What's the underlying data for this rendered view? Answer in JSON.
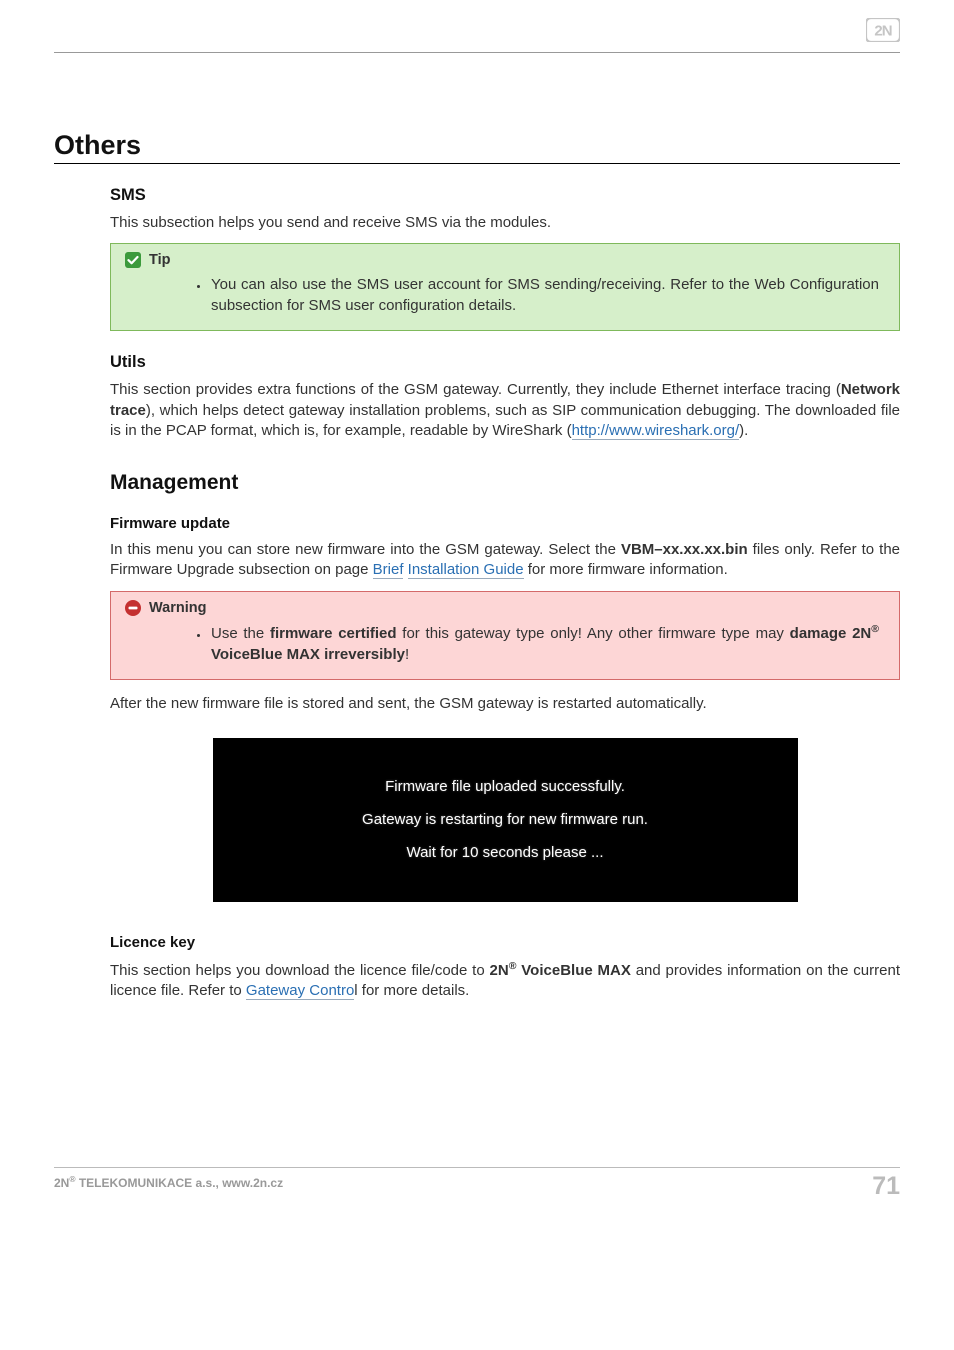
{
  "brand": "2N",
  "section_title": "Others",
  "sms": {
    "heading": "SMS",
    "intro": "This subsection helps you send and receive SMS via the modules.",
    "tip_label": "Tip",
    "tip_text": "You can also use the SMS user account for SMS sending/receiving. Refer to the Web Configuration subsection for SMS user configuration details."
  },
  "utils": {
    "heading": "Utils",
    "text_before_bold": "This section provides extra functions of the GSM gateway. Currently, they include Ethernet interface tracing (",
    "bold": "Network trace",
    "text_after_bold": "), which helps detect gateway installation problems, such as SIP communication debugging. The downloaded file is in the PCAP format, which is, for example, readable by WireShark (",
    "link": "http://www.wireshark.org/",
    "text_end": ")."
  },
  "management": {
    "heading": "Management",
    "fw": {
      "heading": "Firmware update",
      "p1_before": "In this menu you can store new firmware into the GSM gateway. Select the ",
      "p1_bold": "VBM–xx.xx.xx.bin",
      "p1_after": " files only. Refer to the Firmware Upgrade subsection on page ",
      "link_before": "Brief",
      "link_after": "Installation Guide",
      "p1_end": " for more firmware information.",
      "warn_label": "Warning",
      "warn_a": "Use the ",
      "warn_b": "firmware certified",
      "warn_c": " for this gateway type only! Any other firmware type may ",
      "warn_d": "damage 2N",
      "warn_e": " VoiceBlue MAX irreversibly",
      "warn_f": "!",
      "p2": "After the new firmware file is stored and sent, the GSM gateway is restarted automatically.",
      "dlg_line1": "Firmware file uploaded successfully.",
      "dlg_line2": "Gateway is restarting for new firmware run.",
      "dlg_line3": "Wait for 10 seconds please ..."
    },
    "lic": {
      "heading": "Licence key",
      "p_before": "This section helps you download the licence file/code to ",
      "p_bold_a": "2N",
      "p_bold_b": " VoiceBlue MAX",
      "p_after": " and provides information on the current licence file. Refer to ",
      "link": "Gateway Contro",
      "p_end": "l for more details."
    }
  },
  "footer": {
    "left_a": "2N",
    "left_b": " TELEKOMUNIKACE a.s., www.2n.cz",
    "page_number": "71"
  }
}
